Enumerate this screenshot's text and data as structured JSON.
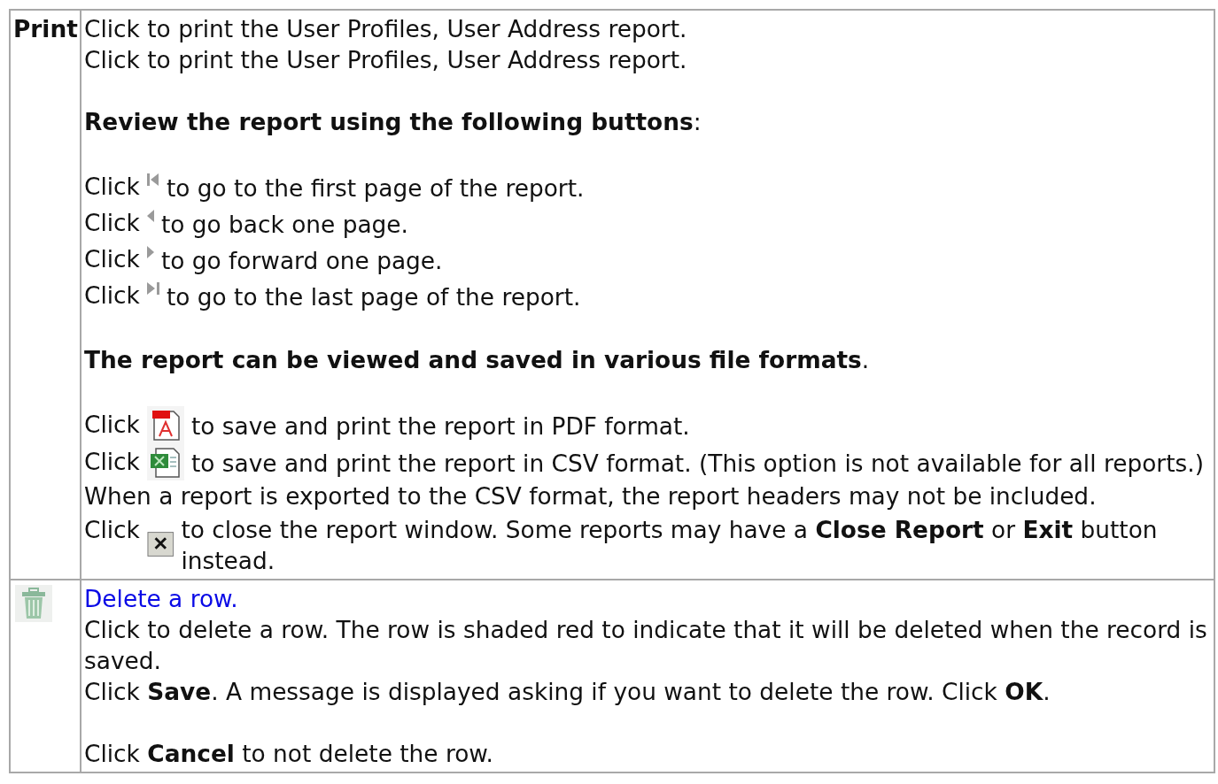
{
  "rows": [
    {
      "label": {
        "kind": "text",
        "text": "Print"
      },
      "lines": [
        {
          "kind": "text",
          "text": "Click to print the User Profiles, User Address report."
        },
        {
          "kind": "text",
          "text": "Click to print the User Profiles, User Address report."
        },
        {
          "kind": "blank"
        },
        {
          "kind": "text",
          "text": "**Review the report using the following buttons**:"
        },
        {
          "kind": "blank"
        },
        {
          "kind": "first",
          "before": "Click",
          "after": "to go to the first page of the report."
        },
        {
          "kind": "prev",
          "before": "Click",
          "after": "to go back one page."
        },
        {
          "kind": "next",
          "before": "Click",
          "after": "to go forward one page."
        },
        {
          "kind": "last",
          "before": "Click",
          "after": "to go to the last page of the report."
        },
        {
          "kind": "blank"
        },
        {
          "kind": "text",
          "text": "**The report can be viewed and saved in various file formats**."
        },
        {
          "kind": "blank"
        },
        {
          "kind": "pdf",
          "before": "Click",
          "after": "to save and print the report in PDF format."
        },
        {
          "kind": "csv",
          "before": "Click",
          "after": "to save and print the report in CSV format. (This option is not available for all reports.)"
        },
        {
          "kind": "text",
          "text": "When a report is exported to the CSV format, the report headers may not be included."
        },
        {
          "kind": "close",
          "before": "Click",
          "after": "to close the report window. Some reports may have a **Close Report** or **Exit** button instead."
        }
      ]
    },
    {
      "label": {
        "kind": "trash"
      },
      "lines": [
        {
          "kind": "link",
          "text": "Delete a row."
        },
        {
          "kind": "text",
          "text": "Click to delete a row. The row is shaded red to indicate that it will be deleted when the record is saved."
        },
        {
          "kind": "text",
          "text": "Click **Save**. A message is displayed asking if you want to delete the row. Click **OK**."
        },
        {
          "kind": "blank"
        },
        {
          "kind": "text",
          "text": "Click **Cancel** to not delete the row."
        }
      ]
    }
  ]
}
